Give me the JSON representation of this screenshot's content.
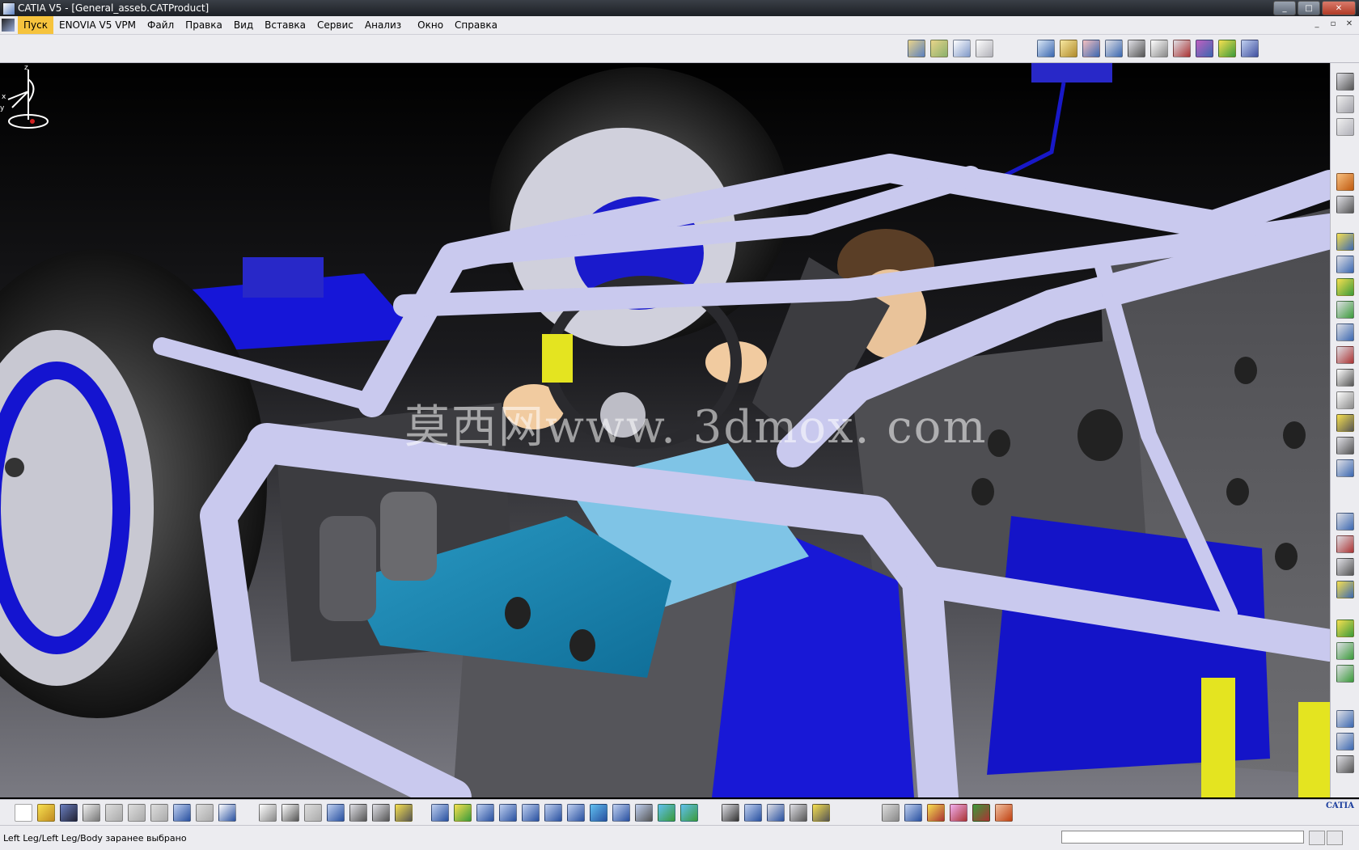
{
  "window": {
    "title": "CATIA V5 - [General_asseb.CATProduct]",
    "controls": [
      "_",
      "□",
      "✕"
    ]
  },
  "menu": {
    "items": [
      "Пуск",
      "ENOVIA V5 VPM",
      "Файл",
      "Правка",
      "Вид",
      "Вставка",
      "Сервис",
      "Анализ",
      "Окно",
      "Справка"
    ],
    "mdi_controls": [
      "_",
      "▫",
      "✕"
    ]
  },
  "viewport": {
    "watermark": "莫西网www. 3dmox. com",
    "compass_axes": {
      "x": "x",
      "y": "y",
      "z": "z"
    }
  },
  "logo": {
    "text": "CATIA"
  },
  "status": {
    "message": "Left Leg/Left Leg/Body заранее выбрано",
    "command_value": ""
  },
  "colors": {
    "frame_tube": "#c9c9ee",
    "blue_part": "#1212d0",
    "active_menu": "#f6c33d"
  }
}
